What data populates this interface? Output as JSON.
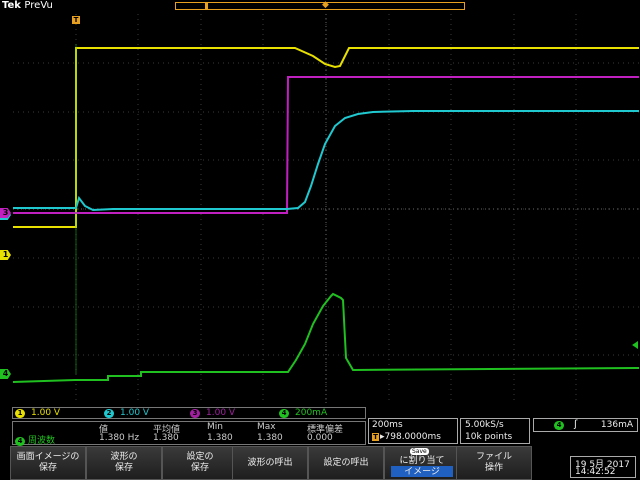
{
  "header": {
    "brand": "Tek",
    "mode": "PreVu"
  },
  "trigger_marker": "T",
  "trigger_position_symbol": "◆",
  "channels": [
    {
      "num": "1",
      "scale": "1.00 V",
      "color": "#e8e000"
    },
    {
      "num": "2",
      "scale": "1.00 V",
      "color": "#20c8d0"
    },
    {
      "num": "3",
      "scale": "1.00 V",
      "color": "#a020a0"
    },
    {
      "num": "4",
      "scale": "200mA",
      "color": "#20c020"
    }
  ],
  "measurement": {
    "source_num": "4",
    "source_label": "周波数",
    "headers": [
      "値",
      "平均値",
      "Min",
      "Max",
      "標準偏差"
    ],
    "values": [
      "1.380 Hz",
      "1.380",
      "1.380",
      "1.380",
      "0.000"
    ]
  },
  "timebase": {
    "scale": "200ms",
    "delay_marker": "T",
    "delay": "▸798.0000ms"
  },
  "acquisition": {
    "rate": "5.00kS/s",
    "length": "10k points"
  },
  "trigger": {
    "source": "4",
    "slope": "ʃ",
    "level": "136mA"
  },
  "menu": [
    "画面イメージの\n保存",
    "波形の\n保存",
    "設定の\n保存",
    "波形の呼出",
    "設定の呼出",
    "に割り当て\nイメージ",
    "ファイル\n操作"
  ],
  "save_tag": "Save",
  "clock": {
    "date": "19 5月 2017",
    "time": "14:42:52"
  }
}
